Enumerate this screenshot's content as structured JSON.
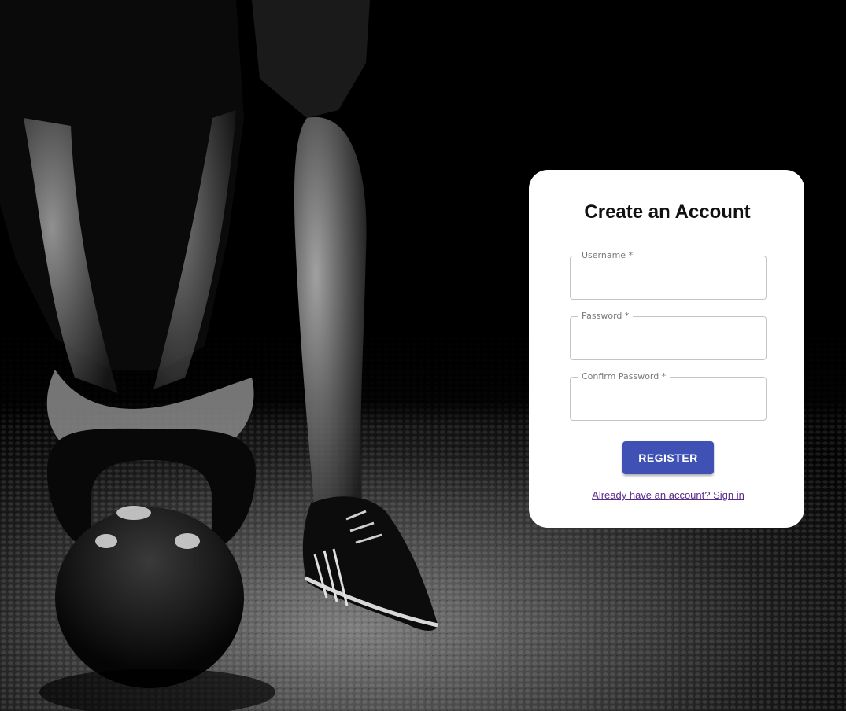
{
  "form": {
    "title": "Create an Account",
    "fields": [
      {
        "label": "Username *",
        "value": "",
        "placeholder": ""
      },
      {
        "label": "Password *",
        "value": "",
        "placeholder": ""
      },
      {
        "label": "Confirm Password *",
        "value": "",
        "placeholder": ""
      }
    ],
    "register_label": "REGISTER",
    "signin_link": "Already have an account? Sign in"
  },
  "colors": {
    "background": "#000000",
    "card": "#ffffff",
    "button": "#3f51b5",
    "link": "#5b2a8a",
    "field_border": "#c4c4c4",
    "field_label": "#7a7a7a"
  },
  "background_image": {
    "icon": "kettlebell-athlete-photo"
  }
}
